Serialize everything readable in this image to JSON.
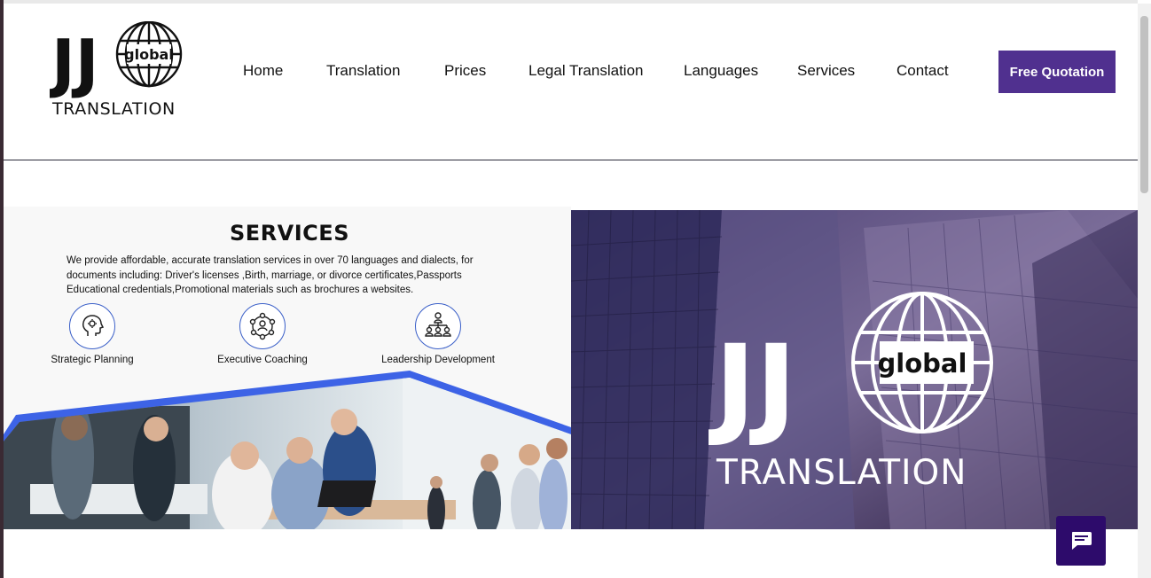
{
  "header": {
    "logo": {
      "letters": "JJ",
      "globe_word": "global",
      "word": "TRANSLATION"
    },
    "nav": [
      "Home",
      "Translation",
      "Prices",
      "Legal Translation",
      "Languages",
      "Services",
      "Contact"
    ],
    "cta_label": "Free Quotation",
    "cta_color": "#50308f"
  },
  "hero": {
    "services_title": "SERVICES",
    "services_desc_lines": [
      "We provide affordable, accurate translation services in over 70 languages and dialects, for",
      "documents including: Driver's licenses ,Birth, marriage, or divorce certificates,Passports",
      "Educational credentials,Promotional materials such as brochures a websites."
    ],
    "features": [
      {
        "label": "Strategic Planning",
        "icon": "head-idea-icon"
      },
      {
        "label": "Executive Coaching",
        "icon": "people-network-icon"
      },
      {
        "label": "Leadership Development",
        "icon": "org-chart-icon"
      }
    ],
    "team_photo_icon": "team-meeting-photo",
    "banner": {
      "letters": "JJ",
      "globe_word": "global",
      "word": "TRANSLATION"
    }
  },
  "chat": {
    "icon": "chat-bubble-icon",
    "color": "#2d0b6b"
  },
  "colors": {
    "accent_blue": "#3d63e6",
    "brand_purple": "#50308f"
  }
}
